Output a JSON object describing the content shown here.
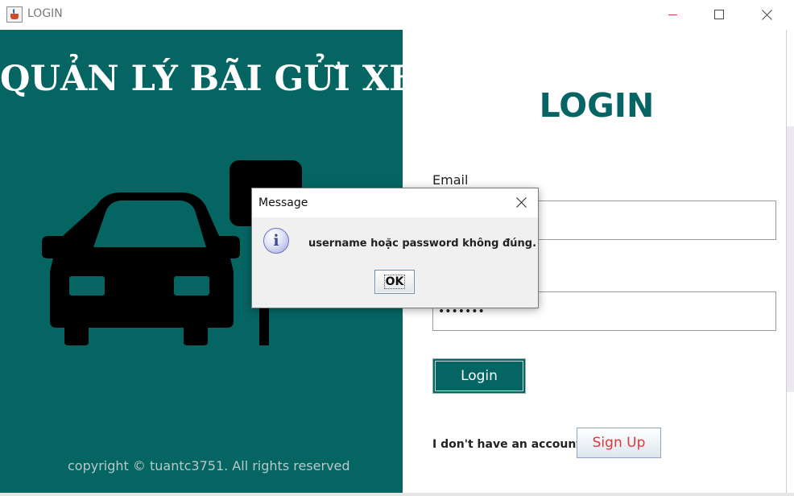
{
  "window": {
    "title": "LOGIN",
    "icon": "java-cup-icon",
    "controls": [
      "minimize-icon",
      "maximize-icon",
      "close-icon"
    ]
  },
  "left_panel": {
    "background": "#056563",
    "title": "QUẢN LÝ BÃI GỬI XE",
    "illustration": "car-parking-sign-icon",
    "copyright": "copyright © tuantc3751. All rights reserved"
  },
  "right_panel": {
    "heading": "LOGIN",
    "email_label": "Email",
    "email_value": "",
    "password_value": "•••••••",
    "login_button": "Login",
    "no_account_text": "I don't have an account",
    "signup_button": "Sign Up"
  },
  "dialog": {
    "title": "Message",
    "icon": "info-icon",
    "icon_glyph": "i",
    "message": "username hoặc password không đúng.",
    "ok_button": "OK"
  },
  "colors": {
    "accent": "#056563",
    "heading": "#066464",
    "signup_text": "#e0353a"
  }
}
